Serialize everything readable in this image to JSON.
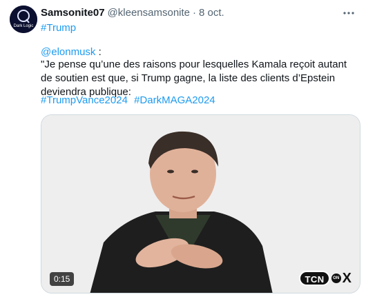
{
  "tweet": {
    "author": {
      "display_name": "Samsonite07",
      "handle": "@kleensamsonite",
      "separator": "·",
      "date": "8 oct.",
      "avatar_icon": "dark-logo-avatar",
      "avatar_text": "Dark Logic"
    },
    "more_icon": "more-options-icon",
    "first_hashtag": "#Trump",
    "mention": "@elonmusk",
    "mention_suffix": " :",
    "quote_text": "\"Je pense qu’une des raisons pour lesquelles Kamala reçoit autant de soutien est que, si Trump gagne, la liste des clients d’Epstein deviendra publique:",
    "hashtags": [
      "#TrumpVance2024",
      "#DarkMAGA2024"
    ],
    "media": {
      "type": "video",
      "duration": "0:15",
      "brand_label": "TCN",
      "brand_on": "ON",
      "brand_x": "X"
    }
  },
  "colors": {
    "link": "#1d9bf0",
    "text": "#0f1419",
    "secondary": "#536471"
  }
}
